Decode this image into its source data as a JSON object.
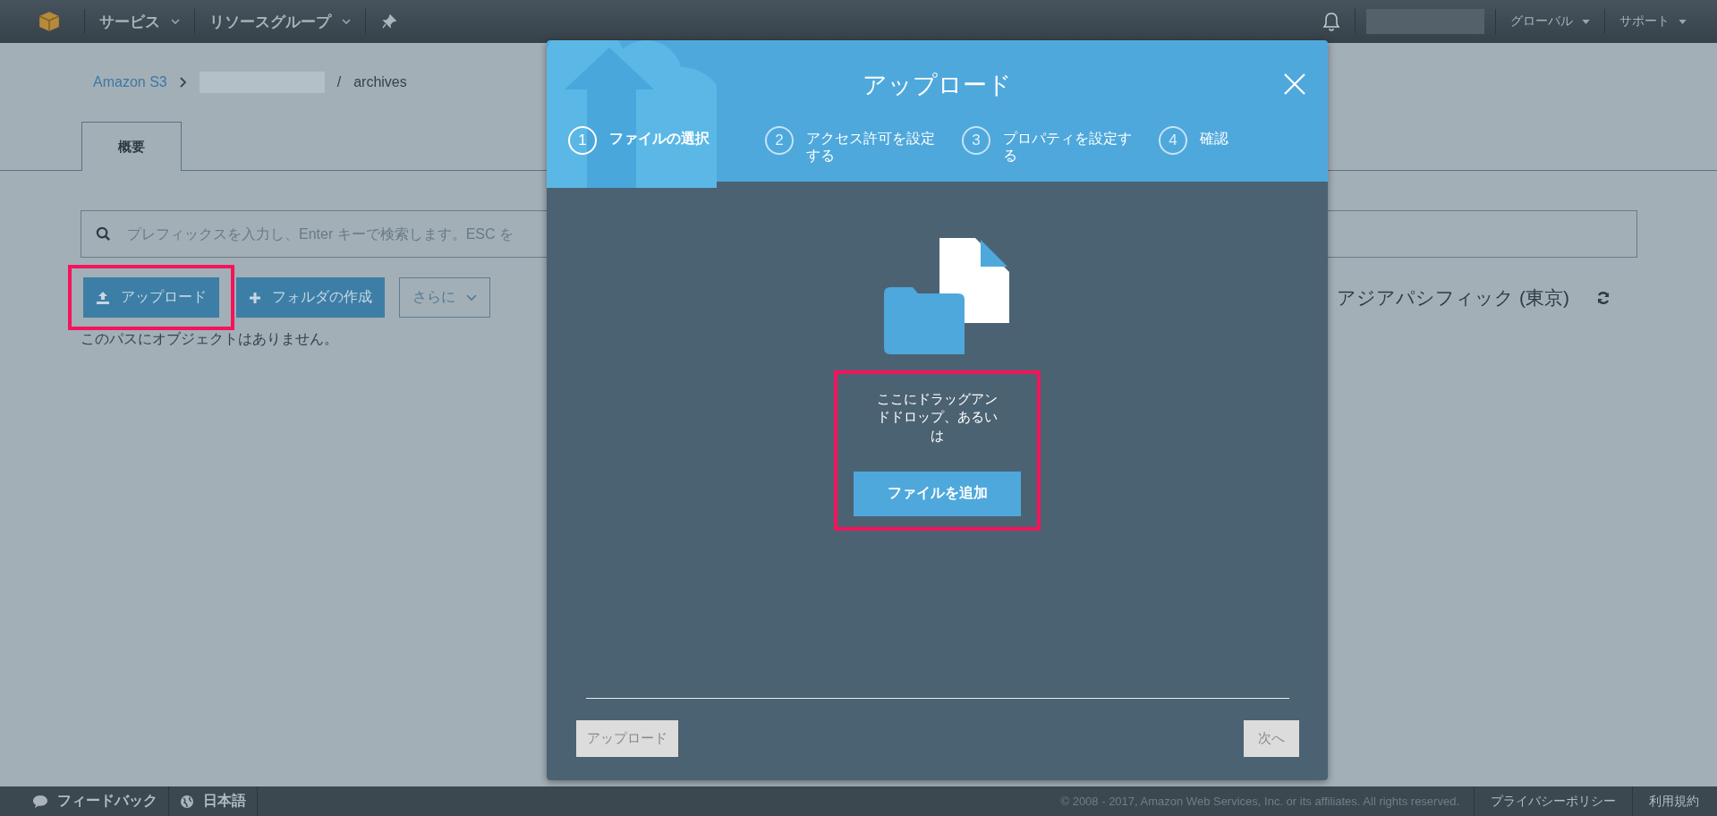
{
  "top_nav": {
    "menus": [
      {
        "label": "サービス"
      },
      {
        "label": "リソースグループ"
      }
    ],
    "right_menus": [
      {
        "label": "グローバル"
      },
      {
        "label": "サポート"
      }
    ]
  },
  "breadcrumb": {
    "root": "Amazon S3",
    "separator": "/",
    "current": "archives"
  },
  "tabs": [
    {
      "label": "概要",
      "selected": true
    }
  ],
  "search": {
    "placeholder": "プレフィックスを入力し、Enter キーで検索します。ESC を"
  },
  "actions": [
    {
      "kind": "upload",
      "label": "アップロード",
      "highlighted": true
    },
    {
      "kind": "create-folder",
      "label": "フォルダの作成",
      "highlighted": false
    },
    {
      "kind": "dropdown",
      "label": "さらに",
      "highlighted": false
    }
  ],
  "empty_message": "このパスにオブジェクトはありません。",
  "region": "アジアパシフィック (東京)",
  "modal": {
    "title": "アップロード",
    "steps": [
      {
        "number": "1",
        "label": "ファイルの選択",
        "selected": true
      },
      {
        "number": "2",
        "label": "アクセス許可を設定する",
        "selected": false
      },
      {
        "number": "3",
        "label": "プロパティを設定する",
        "selected": false
      },
      {
        "number": "4",
        "label": "確認",
        "selected": false
      }
    ],
    "drop_text": "ここにドラッグアンドドロップ、あるいは",
    "add_button": "ファイルを追加",
    "drop_highlighted": true,
    "footer_buttons": [
      {
        "kind": "back",
        "label": "アップロード",
        "disabled": true
      },
      {
        "kind": "next",
        "label": "次へ",
        "disabled": true
      }
    ]
  },
  "footer": {
    "items": [
      {
        "kind": "feedback",
        "label": "フィードバック"
      },
      {
        "kind": "language",
        "label": "日本語"
      }
    ],
    "copyright": "© 2008 - 2017, Amazon Web Services, Inc. or its affiliates. All rights reserved.",
    "links": [
      "プライバシーポリシー",
      "利用規約"
    ]
  }
}
